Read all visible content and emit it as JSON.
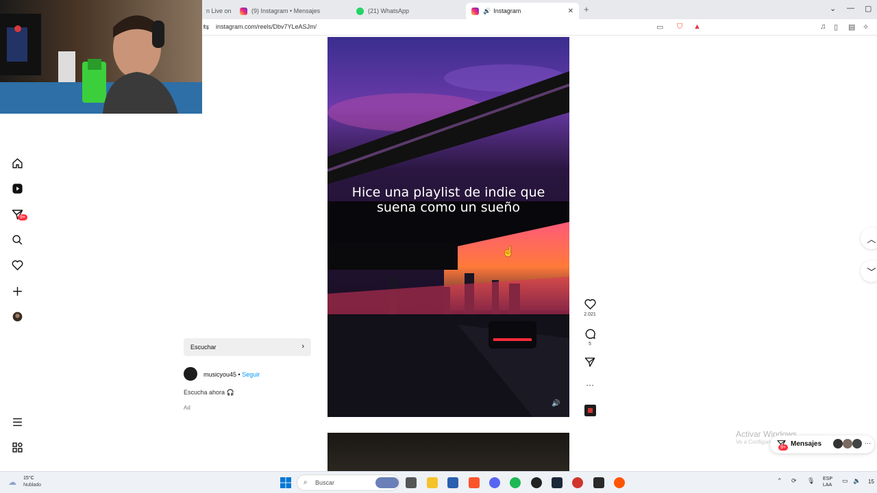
{
  "browser": {
    "tabs": [
      {
        "label": "n Live on",
        "favicon": "none"
      },
      {
        "label": "(9) Instagram • Mensajes",
        "favicon": "instagram"
      },
      {
        "label": "(21) WhatsApp",
        "favicon": "whatsapp"
      },
      {
        "label": "Instagram",
        "favicon": "instagram",
        "active": true,
        "audio": true
      }
    ],
    "url": "instagram.com/reels/Dbv7YLeASJm/"
  },
  "nav": {
    "items": [
      "home-icon",
      "reels-icon",
      "messages-icon",
      "search-icon",
      "notifications-icon",
      "create-icon",
      "profile-icon"
    ],
    "messages_badge": "9+",
    "more_icon": "menu-icon",
    "meta_icon": "apps-icon"
  },
  "reel": {
    "caption_line1": "Hice una playlist de indie que",
    "caption_line2": "suena como un sueño",
    "likes": "2.021",
    "comments": "5"
  },
  "post": {
    "listen_label": "Escuchar",
    "author": "musicyou45",
    "separator": "•",
    "follow_label": "Seguir",
    "description": "Escucha ahora 🎧",
    "ad_label": "Ad"
  },
  "overlay": {
    "activate_title": "Activar Windows",
    "activate_sub": "Ve a Configuración para activar Windows.",
    "messages_label": "Mensajes",
    "messages_badge": "9+"
  },
  "taskbar": {
    "temp": "15°C",
    "weather": "Nublado",
    "search_placeholder": "Buscar",
    "lang1": "ESP",
    "lang2": "LAA",
    "clock": "15"
  },
  "colors": {
    "accent": "#0095f6",
    "badge": "#ff3040"
  }
}
